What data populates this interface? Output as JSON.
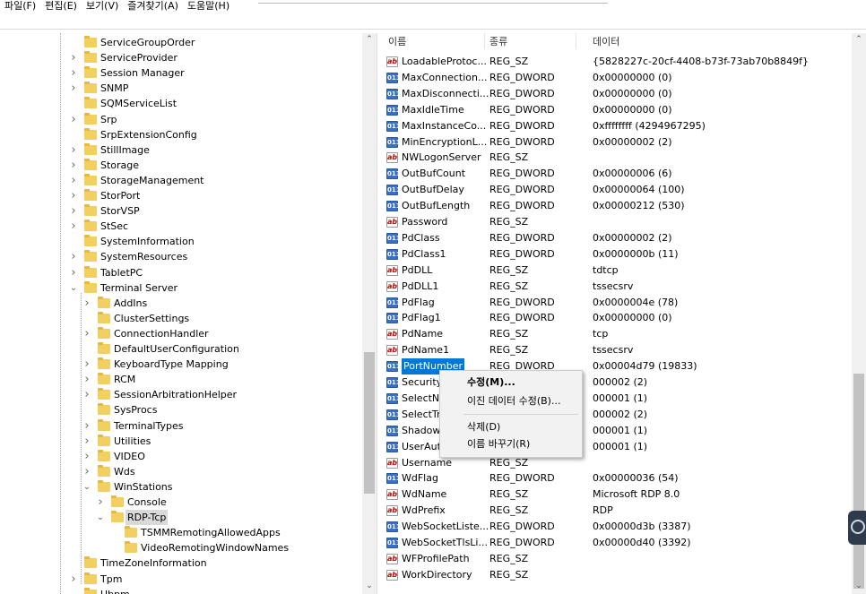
{
  "menu": [
    "파일(F)",
    "편집(E)",
    "보기(V)",
    "즐겨찾기(A)",
    "도움말(H)"
  ],
  "tree": [
    {
      "label": "ServiceGroupOrder",
      "level": 0,
      "expander": "none"
    },
    {
      "label": "ServiceProvider",
      "level": 0,
      "expander": "collapsed"
    },
    {
      "label": "Session Manager",
      "level": 0,
      "expander": "collapsed"
    },
    {
      "label": "SNMP",
      "level": 0,
      "expander": "collapsed"
    },
    {
      "label": "SQMServiceList",
      "level": 0,
      "expander": "none"
    },
    {
      "label": "Srp",
      "level": 0,
      "expander": "collapsed"
    },
    {
      "label": "SrpExtensionConfig",
      "level": 0,
      "expander": "none"
    },
    {
      "label": "StillImage",
      "level": 0,
      "expander": "collapsed"
    },
    {
      "label": "Storage",
      "level": 0,
      "expander": "collapsed"
    },
    {
      "label": "StorageManagement",
      "level": 0,
      "expander": "collapsed"
    },
    {
      "label": "StorPort",
      "level": 0,
      "expander": "collapsed"
    },
    {
      "label": "StorVSP",
      "level": 0,
      "expander": "collapsed"
    },
    {
      "label": "StSec",
      "level": 0,
      "expander": "collapsed"
    },
    {
      "label": "SystemInformation",
      "level": 0,
      "expander": "none"
    },
    {
      "label": "SystemResources",
      "level": 0,
      "expander": "collapsed"
    },
    {
      "label": "TabletPC",
      "level": 0,
      "expander": "collapsed"
    },
    {
      "label": "Terminal Server",
      "level": 0,
      "expander": "expanded"
    },
    {
      "label": "AddIns",
      "level": 1,
      "expander": "collapsed"
    },
    {
      "label": "ClusterSettings",
      "level": 1,
      "expander": "none"
    },
    {
      "label": "ConnectionHandler",
      "level": 1,
      "expander": "collapsed"
    },
    {
      "label": "DefaultUserConfiguration",
      "level": 1,
      "expander": "none"
    },
    {
      "label": "KeyboardType Mapping",
      "level": 1,
      "expander": "collapsed"
    },
    {
      "label": "RCM",
      "level": 1,
      "expander": "collapsed"
    },
    {
      "label": "SessionArbitrationHelper",
      "level": 1,
      "expander": "collapsed"
    },
    {
      "label": "SysProcs",
      "level": 1,
      "expander": "none"
    },
    {
      "label": "TerminalTypes",
      "level": 1,
      "expander": "collapsed"
    },
    {
      "label": "Utilities",
      "level": 1,
      "expander": "collapsed"
    },
    {
      "label": "VIDEO",
      "level": 1,
      "expander": "collapsed"
    },
    {
      "label": "Wds",
      "level": 1,
      "expander": "collapsed"
    },
    {
      "label": "WinStations",
      "level": 1,
      "expander": "expanded"
    },
    {
      "label": "Console",
      "level": 2,
      "expander": "collapsed"
    },
    {
      "label": "RDP-Tcp",
      "level": 2,
      "expander": "expanded",
      "selected": true
    },
    {
      "label": "TSMMRemotingAllowedApps",
      "level": 3,
      "expander": "none"
    },
    {
      "label": "VideoRemotingWindowNames",
      "level": 3,
      "expander": "none"
    },
    {
      "label": "TimeZoneInformation",
      "level": 0,
      "expander": "none"
    },
    {
      "label": "Tpm",
      "level": 0,
      "expander": "collapsed"
    },
    {
      "label": "Ubpm",
      "level": 0,
      "expander": "none"
    }
  ],
  "columns": {
    "name": "이름",
    "type": "종류",
    "data": "데이터"
  },
  "values": [
    {
      "name": "LoadableProtoc...",
      "type": "REG_SZ",
      "data": "{5828227c-20cf-4408-b73f-73ab70b8849f}"
    },
    {
      "name": "MaxConnection...",
      "type": "REG_DWORD",
      "data": "0x00000000 (0)"
    },
    {
      "name": "MaxDisconnecti...",
      "type": "REG_DWORD",
      "data": "0x00000000 (0)"
    },
    {
      "name": "MaxIdleTime",
      "type": "REG_DWORD",
      "data": "0x00000000 (0)"
    },
    {
      "name": "MaxInstanceCo...",
      "type": "REG_DWORD",
      "data": "0xffffffff (4294967295)"
    },
    {
      "name": "MinEncryptionL...",
      "type": "REG_DWORD",
      "data": "0x00000002 (2)"
    },
    {
      "name": "NWLogonServer",
      "type": "REG_SZ",
      "data": ""
    },
    {
      "name": "OutBufCount",
      "type": "REG_DWORD",
      "data": "0x00000006 (6)"
    },
    {
      "name": "OutBufDelay",
      "type": "REG_DWORD",
      "data": "0x00000064 (100)"
    },
    {
      "name": "OutBufLength",
      "type": "REG_DWORD",
      "data": "0x00000212 (530)"
    },
    {
      "name": "Password",
      "type": "REG_SZ",
      "data": ""
    },
    {
      "name": "PdClass",
      "type": "REG_DWORD",
      "data": "0x00000002 (2)"
    },
    {
      "name": "PdClass1",
      "type": "REG_DWORD",
      "data": "0x0000000b (11)"
    },
    {
      "name": "PdDLL",
      "type": "REG_SZ",
      "data": "tdtcp"
    },
    {
      "name": "PdDLL1",
      "type": "REG_SZ",
      "data": "tssecsrv"
    },
    {
      "name": "PdFlag",
      "type": "REG_DWORD",
      "data": "0x0000004e (78)"
    },
    {
      "name": "PdFlag1",
      "type": "REG_DWORD",
      "data": "0x00000000 (0)"
    },
    {
      "name": "PdName",
      "type": "REG_SZ",
      "data": "tcp"
    },
    {
      "name": "PdName1",
      "type": "REG_SZ",
      "data": "tssecsrv"
    },
    {
      "name": "PortNumber",
      "type": "REG_DWORD",
      "data": "0x00004d79 (19833)",
      "selected": true
    },
    {
      "name": "Security",
      "type": "",
      "data": "000002 (2)"
    },
    {
      "name": "SelectNe",
      "type": "",
      "data": "000001 (1)"
    },
    {
      "name": "SelectTr",
      "type": "",
      "data": "000002 (2)"
    },
    {
      "name": "Shadow",
      "type": "",
      "data": "000001 (1)"
    },
    {
      "name": "UserAut",
      "type": "",
      "data": "000001 (1)"
    },
    {
      "name": "Username",
      "type": "REG_SZ",
      "data": ""
    },
    {
      "name": "WdFlag",
      "type": "REG_DWORD",
      "data": "0x00000036 (54)"
    },
    {
      "name": "WdName",
      "type": "REG_SZ",
      "data": "Microsoft RDP 8.0"
    },
    {
      "name": "WdPrefix",
      "type": "REG_SZ",
      "data": "RDP"
    },
    {
      "name": "WebSocketListe...",
      "type": "REG_DWORD",
      "data": "0x00000d3b (3387)"
    },
    {
      "name": "WebSocketTlsLi...",
      "type": "REG_DWORD",
      "data": "0x00000d40 (3392)"
    },
    {
      "name": "WFProfilePath",
      "type": "REG_SZ",
      "data": ""
    },
    {
      "name": "WorkDirectory",
      "type": "REG_SZ",
      "data": ""
    }
  ],
  "context_menu": {
    "modify": "수정(M)...",
    "modify_binary": "이진 데이터 수정(B)...",
    "delete": "삭제(D)",
    "rename": "이름 바꾸기(R)"
  },
  "icons": {
    "string": "ab",
    "dword": "011"
  },
  "colors": {
    "selection": "#0078d7",
    "folder": "#f2cf61"
  }
}
